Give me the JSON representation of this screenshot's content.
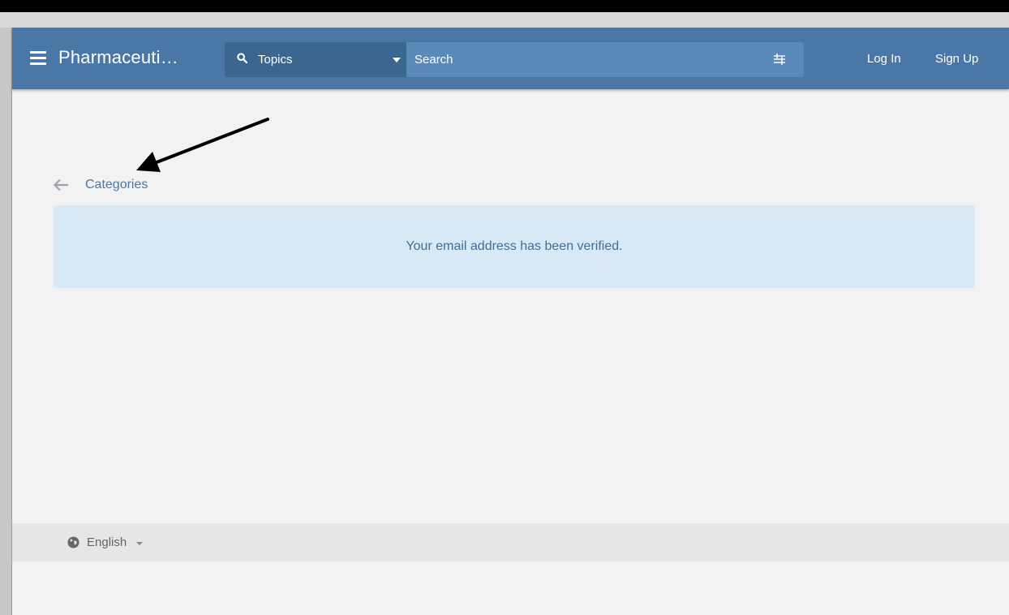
{
  "navbar": {
    "brand": "Pharmaceuti…",
    "topics_label": "Topics",
    "search_placeholder": "Search",
    "login_label": "Log In",
    "signup_label": "Sign Up",
    "background_color": "#4a77a6"
  },
  "breadcrumb": {
    "label": "Categories",
    "icon": "arrow-left-icon"
  },
  "alert": {
    "message": "Your email address has been verified.",
    "background_color": "#d9e8f5"
  },
  "footer": {
    "language": "English",
    "icon": "globe-icon"
  }
}
